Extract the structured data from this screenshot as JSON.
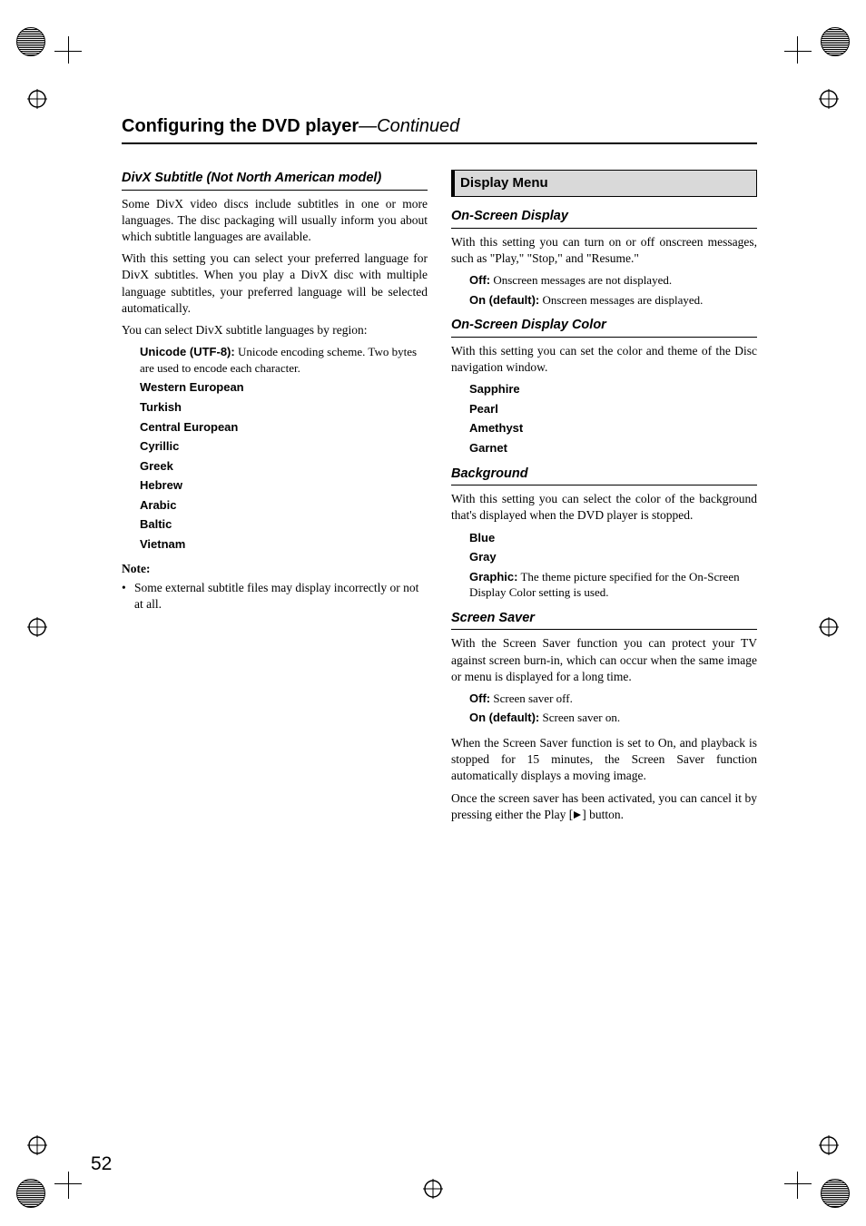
{
  "header": {
    "title": "Configuring the DVD player",
    "continued": "—Continued"
  },
  "left": {
    "sub1": "DivX Subtitle (Not North American model)",
    "p1": "Some DivX video discs include subtitles in one or more languages. The disc packaging will usually inform you about which subtitle languages are available.",
    "p2": "With this setting you can select your preferred language for DivX subtitles. When you play a DivX disc with multiple language subtitles, your preferred language will be selected automatically.",
    "p3": "You can select DivX subtitle languages by region:",
    "opt_unicode_label": "Unicode (UTF-8):",
    "opt_unicode_desc": " Unicode encoding scheme. Two bytes are used to encode each character.",
    "opts": [
      "Western European",
      "Turkish",
      "Central European",
      "Cyrillic",
      "Greek",
      "Hebrew",
      "Arabic",
      "Baltic",
      "Vietnam"
    ],
    "note_label": "Note:",
    "note_bullet": "Some external subtitle files may display incorrectly or not at all."
  },
  "right": {
    "section": "Display Menu",
    "osd": {
      "title": "On-Screen Display",
      "p1": "With this setting you can turn on or off onscreen messages, such as \"Play,\" \"Stop,\" and \"Resume.\"",
      "off_label": "Off:",
      "off_desc": " Onscreen messages are not displayed.",
      "on_label": "On (default):",
      "on_desc": " Onscreen messages are displayed."
    },
    "osd_color": {
      "title": "On-Screen Display Color",
      "p1": "With this setting you can set the color and theme of the Disc navigation window.",
      "opts": [
        "Sapphire",
        "Pearl",
        "Amethyst",
        "Garnet"
      ]
    },
    "background": {
      "title": "Background",
      "p1": "With this setting you can select the color of the background that's displayed when the DVD player is stopped.",
      "opt_blue": "Blue",
      "opt_gray": "Gray",
      "opt_graphic_label": "Graphic:",
      "opt_graphic_desc": " The theme picture specified for the On-Screen Display Color setting is used."
    },
    "screen_saver": {
      "title": "Screen Saver",
      "p1": "With the Screen Saver function you can protect your TV against screen burn-in, which can occur when the same image or menu is displayed for a long time.",
      "off_label": "Off:",
      "off_desc": " Screen saver off.",
      "on_label": "On (default):",
      "on_desc": " Screen saver on.",
      "p2": "When the Screen Saver function is set to On, and playback is stopped for 15 minutes, the Screen Saver function automatically displays a moving image.",
      "p3a": "Once the screen saver has been activated, you can cancel it by pressing either the Play [",
      "p3b": "] button."
    }
  },
  "page_number": "52"
}
